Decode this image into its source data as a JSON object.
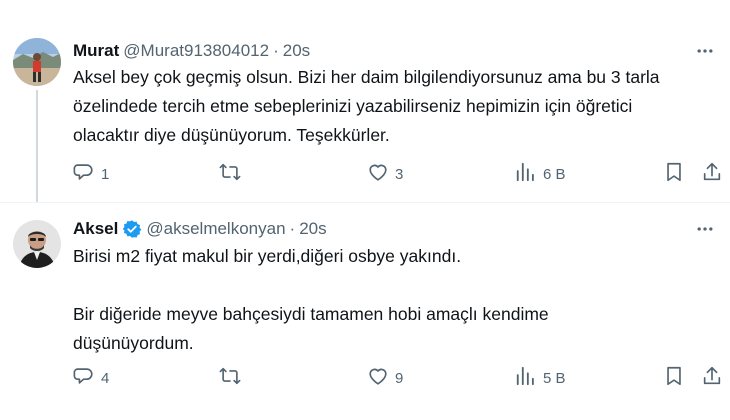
{
  "tweets": [
    {
      "name": "Murat",
      "handle": "@Murat913804012",
      "separator": "·",
      "time": "20s",
      "verified": false,
      "paragraphs": [
        "Aksel bey çok geçmiş olsun. Bizi her daim bilgilendiyorsunuz ama bu 3 tarla özelindede tercih etme sebeplerinizi yazabilirseniz  hepimizin için öğretici olacaktır diye düşünüyorum. Teşekkürler."
      ],
      "stats": {
        "replies": "1",
        "retweets": "",
        "likes": "3",
        "views": "6 B"
      }
    },
    {
      "name": "Aksel",
      "handle": "@akselmelkonyan",
      "separator": "·",
      "time": "20s",
      "verified": true,
      "paragraphs": [
        "Birisi m2 fiyat makul bir yerdi,diğeri osbye yakındı.",
        "Bir diğeride meyve bahçesiydi tamamen hobi amaçlı kendime düşünüyordum."
      ],
      "stats": {
        "replies": "4",
        "retweets": "",
        "likes": "9",
        "views": "5 B"
      }
    }
  ],
  "icons": {
    "more": "more-horizontal-icon",
    "reply": "reply-icon",
    "retweet": "retweet-icon",
    "like": "heart-icon",
    "views": "analytics-icon",
    "bookmark": "bookmark-icon",
    "share": "share-icon",
    "verified": "verified-badge-icon"
  },
  "colors": {
    "text": "#0f1419",
    "secondary": "#536471",
    "verified": "#1d9bf0",
    "divider": "#eff3f4"
  }
}
